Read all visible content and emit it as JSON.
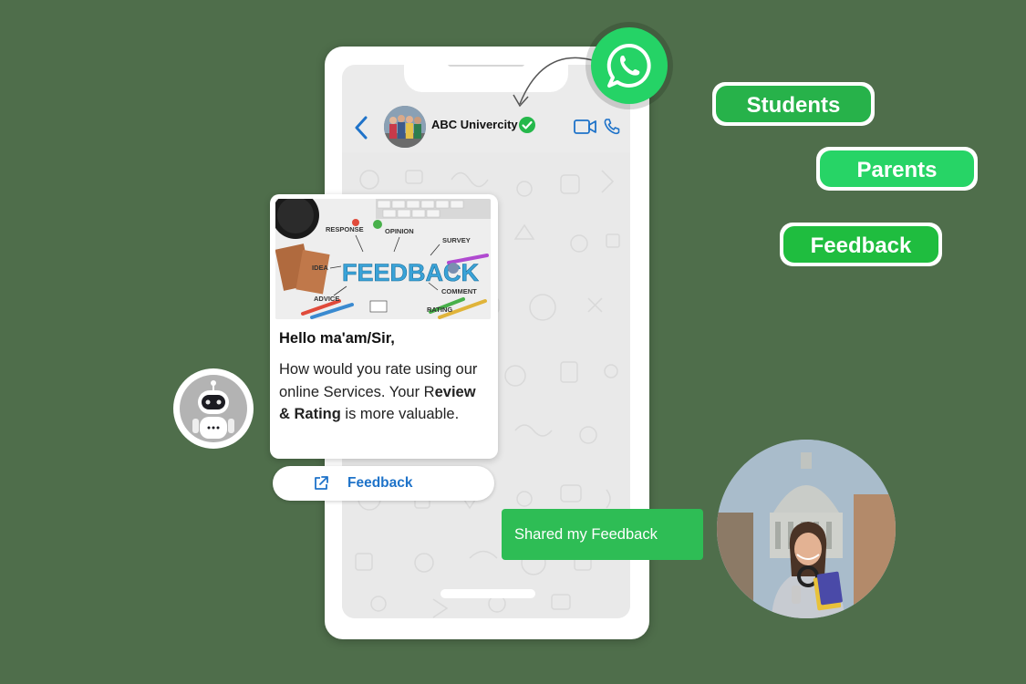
{
  "chat": {
    "contact_name": "ABC Univercity"
  },
  "card": {
    "image_words": [
      "RESPONSE",
      "OPINION",
      "SURVEY",
      "IDEA",
      "FEEDBACK",
      "ADVICE",
      "COMMENT",
      "RATING"
    ],
    "greeting": "Hello ma'am/Sir,",
    "body_part1": "How would you rate using our online Services. Your R",
    "body_bold": "eview & Rating",
    "body_part2": " is more valuable."
  },
  "button": {
    "label": "Feedback"
  },
  "reply": {
    "text": "Shared my Feedback"
  },
  "tags": [
    {
      "label": "Students"
    },
    {
      "label": "Parents"
    },
    {
      "label": "Feedback"
    }
  ],
  "colors": {
    "whatsapp_green": "#25d366",
    "tag_green": "#2ebd55",
    "link_blue": "#1f73c9",
    "background": "#4f6e4b"
  },
  "icons": [
    "whatsapp-icon",
    "back-arrow-icon",
    "verified-icon",
    "video-call-icon",
    "phone-call-icon",
    "external-link-icon",
    "robot-avatar"
  ]
}
